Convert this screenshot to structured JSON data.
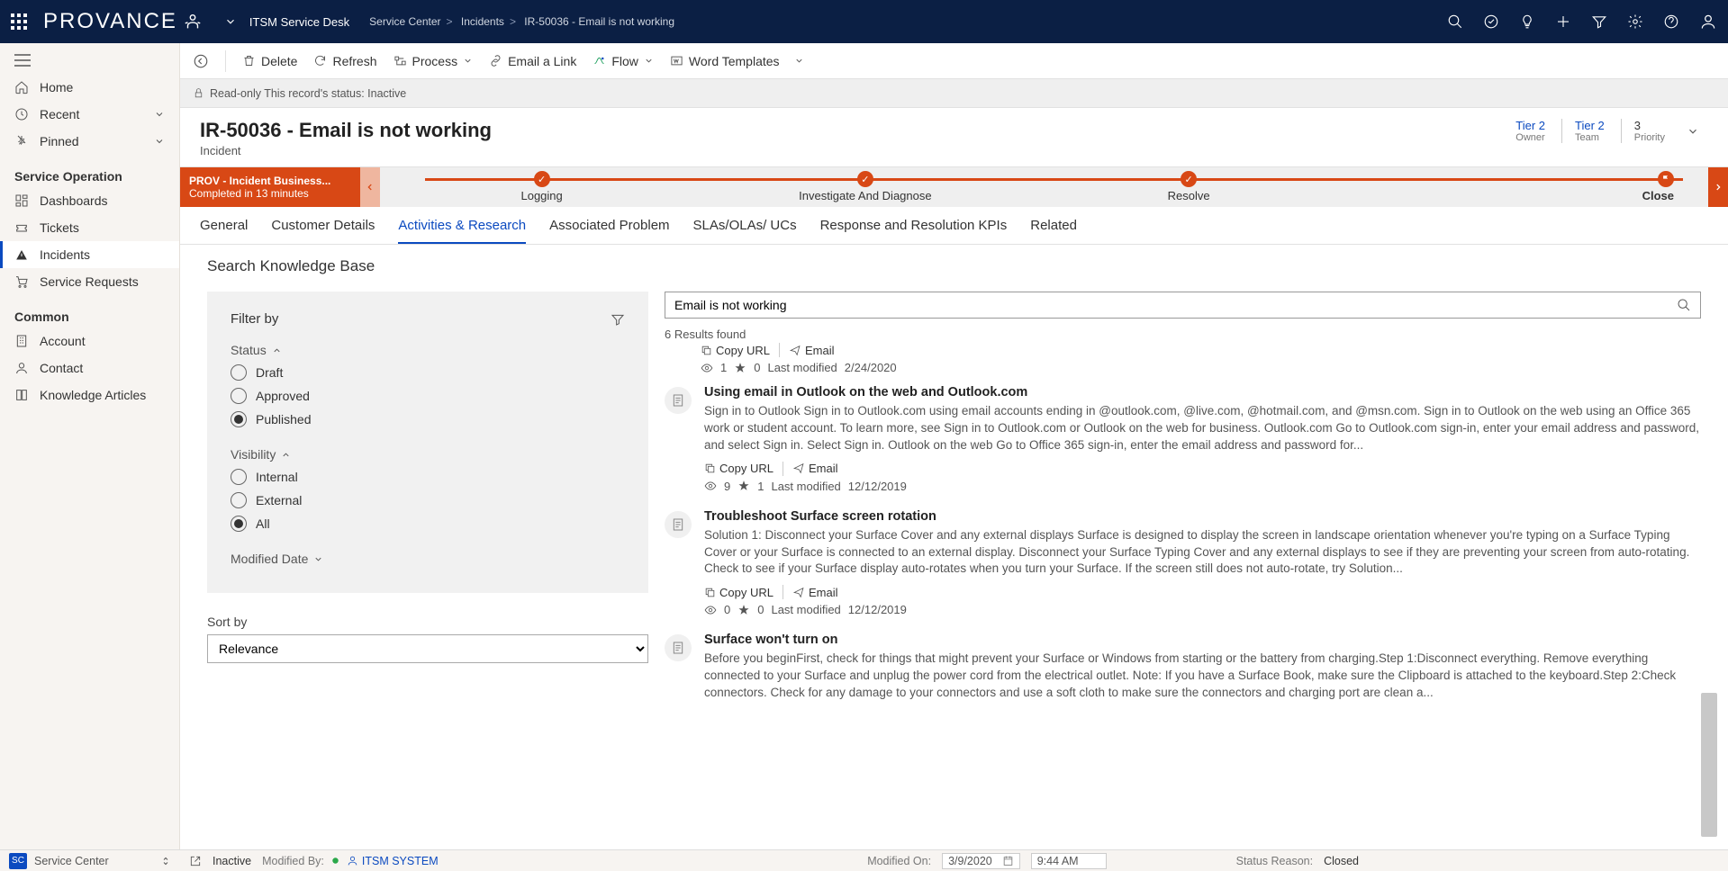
{
  "topbar": {
    "brand": "PROVANCE",
    "desk": "ITSM Service Desk",
    "breadcrumbs": [
      "Service Center",
      "Incidents",
      "IR-50036 - Email is not working"
    ]
  },
  "leftnav": {
    "items_top": [
      {
        "icon": "home",
        "label": "Home"
      },
      {
        "icon": "clock",
        "label": "Recent",
        "chev": true
      },
      {
        "icon": "pin",
        "label": "Pinned",
        "chev": true
      }
    ],
    "section1": "Service Operation",
    "items_op": [
      {
        "icon": "dash",
        "label": "Dashboards"
      },
      {
        "icon": "ticket",
        "label": "Tickets"
      },
      {
        "icon": "alert",
        "label": "Incidents",
        "active": true
      },
      {
        "icon": "cart",
        "label": "Service Requests"
      }
    ],
    "section2": "Common",
    "items_common": [
      {
        "icon": "account",
        "label": "Account"
      },
      {
        "icon": "contact",
        "label": "Contact"
      },
      {
        "icon": "kb",
        "label": "Knowledge Articles"
      }
    ]
  },
  "cmdbar": {
    "delete": "Delete",
    "refresh": "Refresh",
    "process": "Process",
    "email": "Email a Link",
    "flow": "Flow",
    "word": "Word Templates"
  },
  "notice": "Read-only This record's status: Inactive",
  "record": {
    "title": "IR-50036 - Email is not working",
    "entity": "Incident",
    "meta": [
      {
        "val": "Tier 2",
        "lbl": "Owner",
        "link": true
      },
      {
        "val": "Tier 2",
        "lbl": "Team",
        "link": true
      },
      {
        "val": "3",
        "lbl": "Priority",
        "link": false
      }
    ]
  },
  "flow": {
    "name": "PROV - Incident Business...",
    "sub": "Completed in 13 minutes",
    "stages": [
      "Logging",
      "Investigate And Diagnose",
      "Resolve",
      "Close"
    ]
  },
  "tabs": [
    "General",
    "Customer Details",
    "Activities & Research",
    "Associated Problem",
    "SLAs/OLAs/ UCs",
    "Response and Resolution KPIs",
    "Related"
  ],
  "active_tab": "Activities & Research",
  "kb": {
    "title": "Search Knowledge Base",
    "filter": {
      "title": "Filter by",
      "status_label": "Status",
      "status": [
        "Draft",
        "Approved",
        "Published"
      ],
      "status_sel": "Published",
      "visibility_label": "Visibility",
      "visibility": [
        "Internal",
        "External",
        "All"
      ],
      "visibility_sel": "All",
      "modified_label": "Modified Date"
    },
    "sort_label": "Sort by",
    "sort_value": "Relevance",
    "search_value": "Email is not working",
    "results_count": "6 Results found",
    "copy": "Copy URL",
    "emailact": "Email",
    "lastmod": "Last modified",
    "top_meta": {
      "views": "1",
      "rating": "0",
      "date": "2/24/2020"
    },
    "results": [
      {
        "title": "Using email in Outlook on the web and Outlook.com",
        "snip": "Sign in to Outlook Sign in to Outlook.com using email accounts ending in @outlook.com, @live.com, @hotmail.com, and @msn.com. Sign in to Outlook on the web using an Office 365 work or student account. To learn more, see Sign in to Outlook.com or Outlook on the web for business. Outlook.com Go to Outlook.com sign-in, enter your email address and password, and select Sign in. Select Sign in. Outlook on the web Go to Office 365 sign-in, enter the email address and password for...",
        "views": "9",
        "rating": "1",
        "date": "12/12/2019"
      },
      {
        "title": "Troubleshoot Surface screen rotation",
        "snip": "Solution 1: Disconnect your Surface Cover and any external displays Surface is designed to display the screen in landscape orientation whenever you're typing on a Surface Typing Cover or your Surface is connected to an external display. Disconnect your Surface Typing Cover and any external displays to see if they are preventing your screen from auto-rotating. Check to see if your Surface display auto-rotates when you turn your Surface. If the screen still does not auto-rotate, try Solution...",
        "views": "0",
        "rating": "0",
        "date": "12/12/2019"
      },
      {
        "title": "Surface won't turn on",
        "snip": "Before you beginFirst, check for things that might prevent your Surface or Windows from starting or the battery from charging.Step 1:Disconnect everything. Remove everything connected to your Surface and unplug the power cord from the electrical outlet. Note: If you have a Surface Book, make sure the Clipboard is attached to the keyboard.Step 2:Check connectors. Check for any damage to your connectors and use a soft cloth to make sure the connectors and charging port are clean a..."
      }
    ]
  },
  "statusbar": {
    "sc": "SC",
    "sc_label": "Service Center",
    "inactive": "Inactive",
    "modby": "Modified By:",
    "modby_val": "ITSM SYSTEM",
    "modon": "Modified On:",
    "modon_date": "3/9/2020",
    "modon_time": "9:44 AM",
    "reason": "Status Reason:",
    "reason_val": "Closed"
  }
}
